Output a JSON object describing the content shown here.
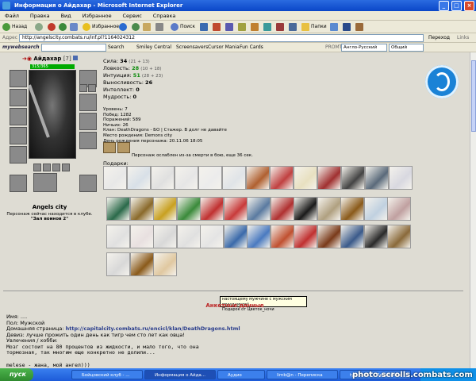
{
  "window": {
    "title": "Информация о Айдахар - Microsoft Internet Explorer",
    "buttons": {
      "minimize": "_",
      "maximize": "□",
      "close": "×"
    }
  },
  "menu": [
    "Файл",
    "Правка",
    "Вид",
    "Избранное",
    "Сервис",
    "Справка"
  ],
  "toolbar": {
    "back": "Назад",
    "favorites": "Избранное",
    "search": "Поиск",
    "folders": "Папки"
  },
  "address": {
    "label": "Адрес",
    "url": "http://angelscity.combats.ru/inf.pl?1164024312",
    "go": "Переход",
    "links": "Links"
  },
  "mywebsearch": {
    "logo": "mywebsearch",
    "items": [
      "Search",
      "Smiley Central",
      "Screensavers",
      "Cursor Mania",
      "Fun Cards"
    ],
    "promt_label": "PROMT",
    "dict_value": "Англо-Русский",
    "topic_value": "Общий"
  },
  "character": {
    "name": "Айдахар",
    "level": "[7]",
    "hp": "315/365",
    "city": "Angels city",
    "location_note": "Персонаж сейчас находится в клубе.",
    "location_room": "\"Зал воинов 2\""
  },
  "stats": [
    {
      "label": "Сила:",
      "value": "34",
      "extra": "(21 + 13)",
      "highlight": false
    },
    {
      "label": "Ловкость:",
      "value": "28",
      "extra": "(10 + 18)",
      "highlight": true
    },
    {
      "label": "Интуиция:",
      "value": "51",
      "extra": "(28 + 23)",
      "highlight": true
    },
    {
      "label": "Выносливость:",
      "value": "26",
      "extra": "",
      "highlight": false
    },
    {
      "label": "Интеллект:",
      "value": "0",
      "extra": "",
      "highlight": false
    },
    {
      "label": "Мудрость:",
      "value": "0",
      "extra": "",
      "highlight": false
    }
  ],
  "info": {
    "level": "Уровень: 7",
    "wins": "Побед: 1282",
    "losses": "Поражений: 589",
    "draws": "Ничьих: 26",
    "clan": "Клан: DeathDragons - БО | Стажер. В долг не давайте",
    "birthplace": "Место рождения: Demons city",
    "birthday": "День рождения персонажа: 20.11.06 18:05"
  },
  "debuff_text": "Персонаж ослаблен из-за смерти в бою, еще 36 сек.",
  "gifts_title": "Подарки:",
  "tooltip": {
    "line1": "настоящему мужчине с мужским праздником)",
    "line2": "Подарок от Цветок_ночи"
  },
  "profile": {
    "section_title": "Анкетные данные",
    "name": "Имя: ....",
    "gender": "Пол: Мужской",
    "homepage_label": "Домашняя страница:",
    "homepage_url": "http://capitalcity.combats.ru/encicl/klan/DeathDragons.html",
    "motto": "Девиз: лучше прожить один день как тигр чем сто лет как овца!",
    "hobby_label": "Увлечения / хобби:",
    "hobby_1": "Мозг состоит на 80 процентов из жидкости, и мало того, что она",
    "hobby_2": "тормозная, так многим еще конкретно не долили...",
    "last_line": "melese - жана, мой ангел)))"
  },
  "taskbar": {
    "start": "пуск",
    "tasks": [
      "Бойцовский клуб - ...",
      "Информация о Айда...",
      "Аудио",
      "limb@n - Переписка",
      "tytcan567 - Переписка"
    ]
  },
  "watermark": "photo.scrolls.combats.com",
  "colors": {
    "accent": "#1a82d6",
    "section_title": "#b22222",
    "link": "#2a3d8c",
    "stat_green": "#0a8a0a"
  }
}
